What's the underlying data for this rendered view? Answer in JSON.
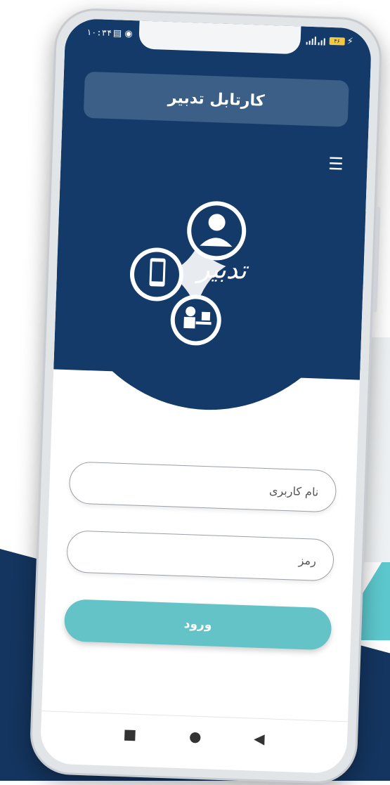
{
  "status_bar": {
    "time": "۱۰:۳۴",
    "left_icons": "▤ ◉",
    "battery": "۴۶"
  },
  "app": {
    "title": "کارتابل تدبیر",
    "logo_text": "تدبیر"
  },
  "login": {
    "username_placeholder": "نام کاربری",
    "password_placeholder": "رمز",
    "submit_label": "ورود"
  },
  "navigation": {
    "menu_icon": "☰",
    "recents": "■",
    "home": "●",
    "back": "◀"
  },
  "colors": {
    "primary": "#143a6a",
    "accent": "#63c3c7",
    "title_bar": "#3b5f86"
  }
}
